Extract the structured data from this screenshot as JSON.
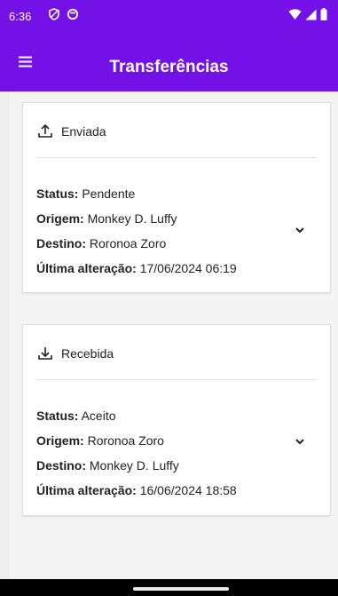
{
  "status_bar": {
    "time": "6:36",
    "left_icons": [
      "shield-icon",
      "circle-status-icon"
    ],
    "right_icons": [
      "wifi-icon",
      "signal-icon",
      "battery-icon"
    ]
  },
  "app_bar": {
    "title": "Transferências",
    "menu_icon": "hamburger-menu-icon",
    "color": "#7411e6"
  },
  "cards": [
    {
      "type_label": "Enviada",
      "type_icon": "upload-icon",
      "status_label": "Status:",
      "status_value": "Pendente",
      "origin_label": "Origem:",
      "origin_value": "Monkey D. Luffy",
      "destination_label": "Destino:",
      "destination_value": "Roronoa Zoro",
      "last_change_label": "Última alteração:",
      "last_change_value": "17/06/2024 06:19",
      "expand_icon": "chevron-down-icon"
    },
    {
      "type_label": "Recebida",
      "type_icon": "download-icon",
      "status_label": "Status:",
      "status_value": "Aceito",
      "origin_label": "Origem:",
      "origin_value": "Roronoa Zoro",
      "destination_label": "Destino:",
      "destination_value": "Monkey D. Luffy",
      "last_change_label": "Última alteração:",
      "last_change_value": "16/06/2024 18:58",
      "expand_icon": "chevron-down-icon"
    }
  ]
}
